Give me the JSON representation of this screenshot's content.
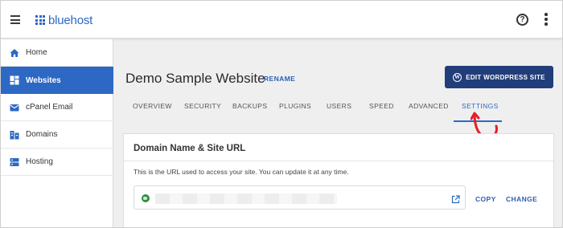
{
  "header": {
    "logo_text": "bluehost",
    "help_label": "?",
    "icons": [
      "menu-icon",
      "help-icon",
      "more-vertical-icon"
    ]
  },
  "sidebar": {
    "items": [
      {
        "label": "Home",
        "icon": "home-icon",
        "active": false
      },
      {
        "label": "Websites",
        "icon": "dashboard-icon",
        "active": true
      },
      {
        "label": "cPanel Email",
        "icon": "mail-icon",
        "active": false
      },
      {
        "label": "Domains",
        "icon": "domains-icon",
        "active": false
      },
      {
        "label": "Hosting",
        "icon": "server-icon",
        "active": false
      }
    ]
  },
  "main": {
    "site_title": "Demo Sample Website",
    "rename_label": "RENAME",
    "edit_button_label": "EDIT WORDPRESS SITE",
    "tabs": [
      {
        "label": "OVERVIEW",
        "active": false
      },
      {
        "label": "SECURITY",
        "active": false
      },
      {
        "label": "BACKUPS",
        "active": false
      },
      {
        "label": "PLUGINS",
        "active": false
      },
      {
        "label": "USERS",
        "active": false
      },
      {
        "label": "SPEED",
        "active": false
      },
      {
        "label": "ADVANCED",
        "active": false
      },
      {
        "label": "SETTINGS",
        "active": true
      }
    ]
  },
  "card": {
    "title": "Domain Name & Site URL",
    "description": "This is the URL used to access your site. You can update it at any time.",
    "copy_label": "COPY",
    "change_label": "CHANGE"
  },
  "colors": {
    "brand_blue": "#2d68c4",
    "button_navy": "#213d7a",
    "annotation_red": "#e0202a",
    "globe_green": "#2f8f3d"
  }
}
